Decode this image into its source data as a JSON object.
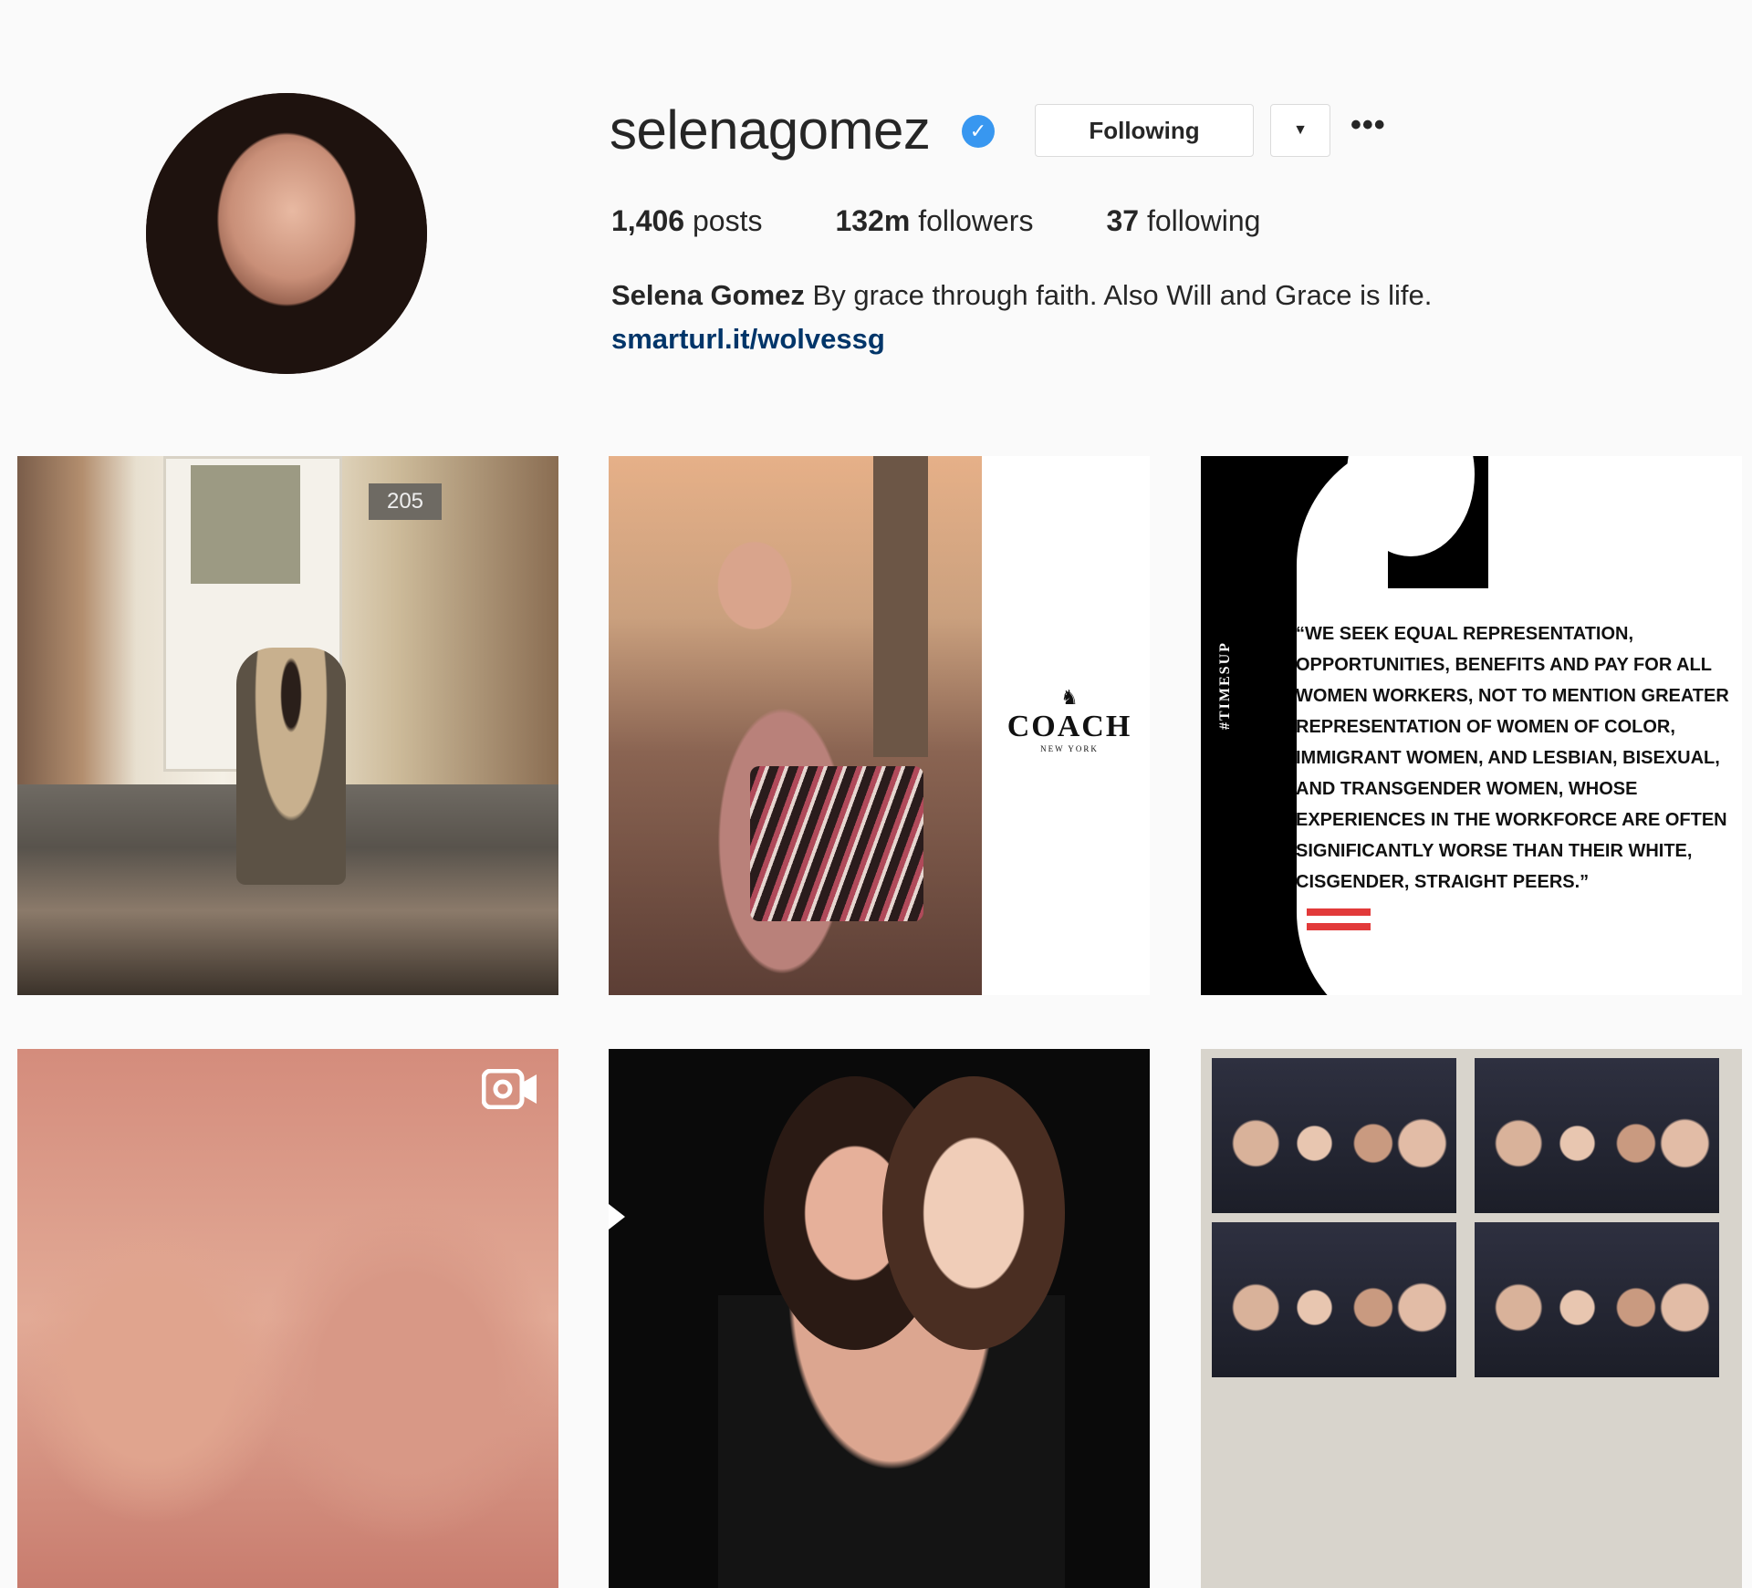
{
  "profile": {
    "username": "selenagomez",
    "verified_icon": "verified-badge-icon",
    "following_label": "Following",
    "dropdown_icon": "caret-down-icon",
    "more_label": "•••",
    "stats": {
      "posts_count": "1,406",
      "posts_label": "posts",
      "followers_count": "132m",
      "followers_label": "followers",
      "following_count": "37",
      "following_label": "following"
    },
    "bio_name": "Selena Gomez",
    "bio_text": " By grace through faith. Also Will and Grace is life.",
    "link": "smarturl.it/wolvessg"
  },
  "posts": {
    "tile1": {
      "house_number": "205"
    },
    "tile2": {
      "brand": "COACH",
      "brand_sub": "NEW YORK"
    },
    "tile3": {
      "tag": "#TIMESUP",
      "quote": "“WE SEEK EQUAL REPRESENTATION, OPPORTUNITIES, BENEFITS AND PAY FOR ALL WOMEN WORKERS, NOT TO MENTION GREATER REPRESENTATION OF WOMEN OF COLOR, IMMIGRANT WOMEN, AND LESBIAN, BISEXUAL, AND TRANSGENDER WOMEN, WHOSE EXPERIENCES IN THE WORKFORCE ARE OFTEN SIGNIFICANTLY WORSE THAN THEIR WHITE, CISGENDER, STRAIGHT PEERS.”"
    },
    "tile4": {
      "type_icon": "video-camera-icon"
    }
  }
}
